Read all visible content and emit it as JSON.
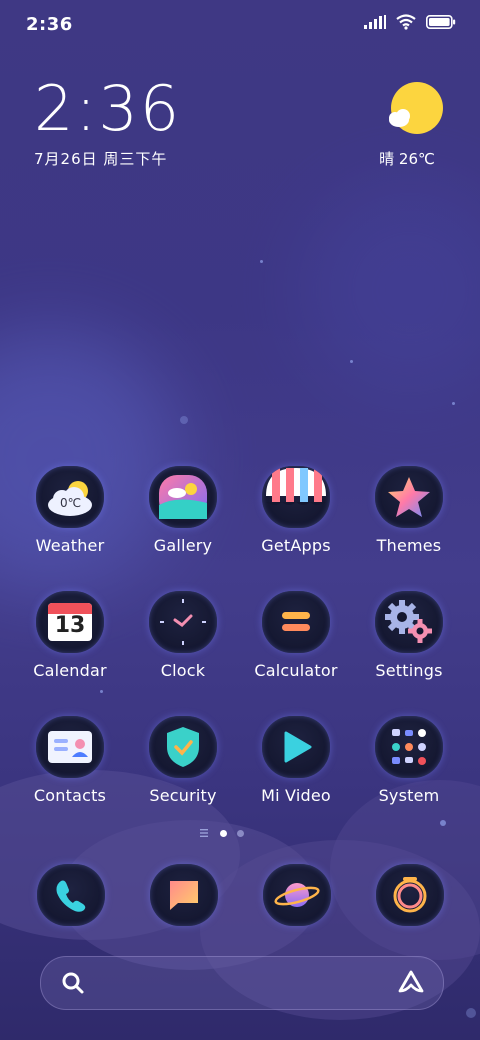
{
  "status_bar": {
    "time": "2:36"
  },
  "clock_widget": {
    "time": "2:36",
    "date": "7月26日 周三下午"
  },
  "weather_widget": {
    "text": "晴 26℃"
  },
  "apps": [
    {
      "label": "Weather",
      "icon": "weather-icon",
      "temp": "0℃"
    },
    {
      "label": "Gallery",
      "icon": "gallery-icon"
    },
    {
      "label": "GetApps",
      "icon": "getapps-icon"
    },
    {
      "label": "Themes",
      "icon": "themes-icon"
    },
    {
      "label": "Calendar",
      "icon": "calendar-icon",
      "day": "13"
    },
    {
      "label": "Clock",
      "icon": "clock-icon"
    },
    {
      "label": "Calculator",
      "icon": "calculator-icon"
    },
    {
      "label": "Settings",
      "icon": "settings-icon"
    },
    {
      "label": "Contacts",
      "icon": "contacts-icon"
    },
    {
      "label": "Security",
      "icon": "security-icon"
    },
    {
      "label": "Mi Video",
      "icon": "video-icon"
    },
    {
      "label": "System",
      "icon": "system-folder-icon"
    }
  ],
  "dock": [
    {
      "name": "phone",
      "icon": "phone-icon"
    },
    {
      "name": "messages",
      "icon": "messages-icon"
    },
    {
      "name": "browser",
      "icon": "planet-icon"
    },
    {
      "name": "camera",
      "icon": "camera-icon"
    }
  ],
  "pages": {
    "total": 2,
    "current": 1
  },
  "colors": {
    "background": "#3f3884",
    "sun": "#fcd53f",
    "accent_pink": "#f48fb1",
    "accent_cyan": "#4dd0e1"
  }
}
